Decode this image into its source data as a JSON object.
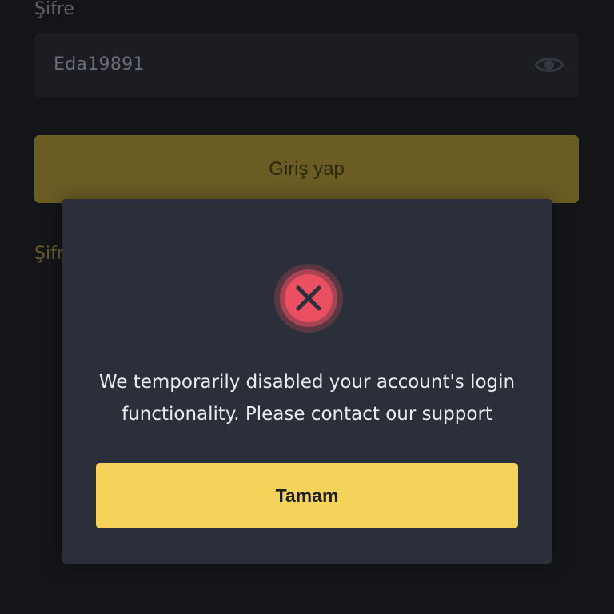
{
  "login_form": {
    "password_label": "Şifre",
    "password_value": "Eda19891",
    "login_button_label": "Giriş yap",
    "forgot_password_partial": "Şifr"
  },
  "dialog": {
    "icon": "error-x-icon",
    "message": "We temporarily disabled your account's login functionality. Please contact our support",
    "confirm_label": "Tamam"
  },
  "colors": {
    "background": "#141519",
    "dialog_background": "#2b2f3a",
    "accent_yellow": "#f5d35b",
    "error_red": "#e9505f"
  }
}
